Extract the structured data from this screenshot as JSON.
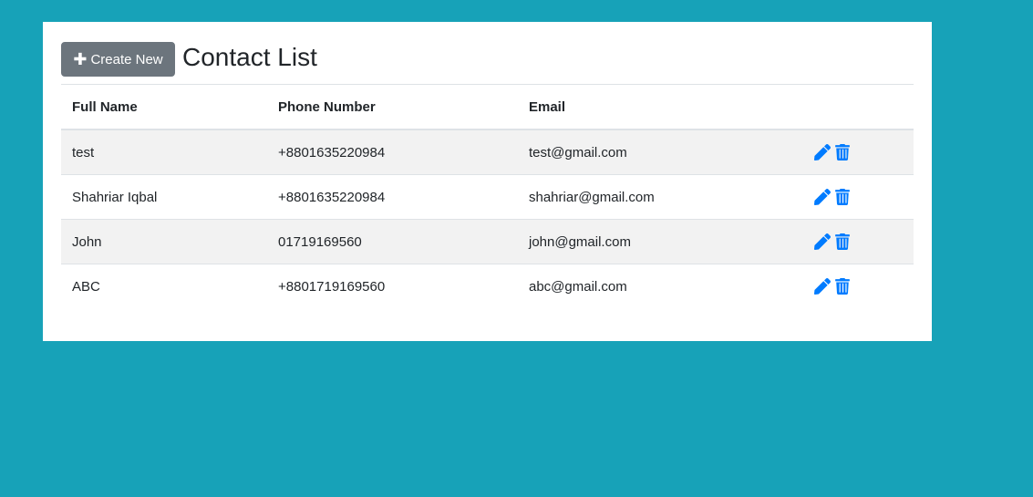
{
  "header": {
    "create_button_label": "Create New",
    "title": "Contact List"
  },
  "table": {
    "columns": [
      "Full Name",
      "Phone Number",
      "Email",
      ""
    ],
    "rows": [
      {
        "name": "test",
        "phone": "+8801635220984",
        "email": "test@gmail.com"
      },
      {
        "name": "Shahriar Iqbal",
        "phone": "+8801635220984",
        "email": "shahriar@gmail.com"
      },
      {
        "name": "John",
        "phone": "01719169560",
        "email": "john@gmail.com"
      },
      {
        "name": "ABC",
        "phone": "+8801719169560",
        "email": "abc@gmail.com"
      }
    ]
  },
  "colors": {
    "background": "#17a2b8",
    "button": "#6c757d",
    "icon": "#007bff",
    "stripe": "#f2f2f2"
  },
  "icons": {
    "create": "plus-icon",
    "edit": "pencil-icon",
    "delete": "trash-icon"
  }
}
